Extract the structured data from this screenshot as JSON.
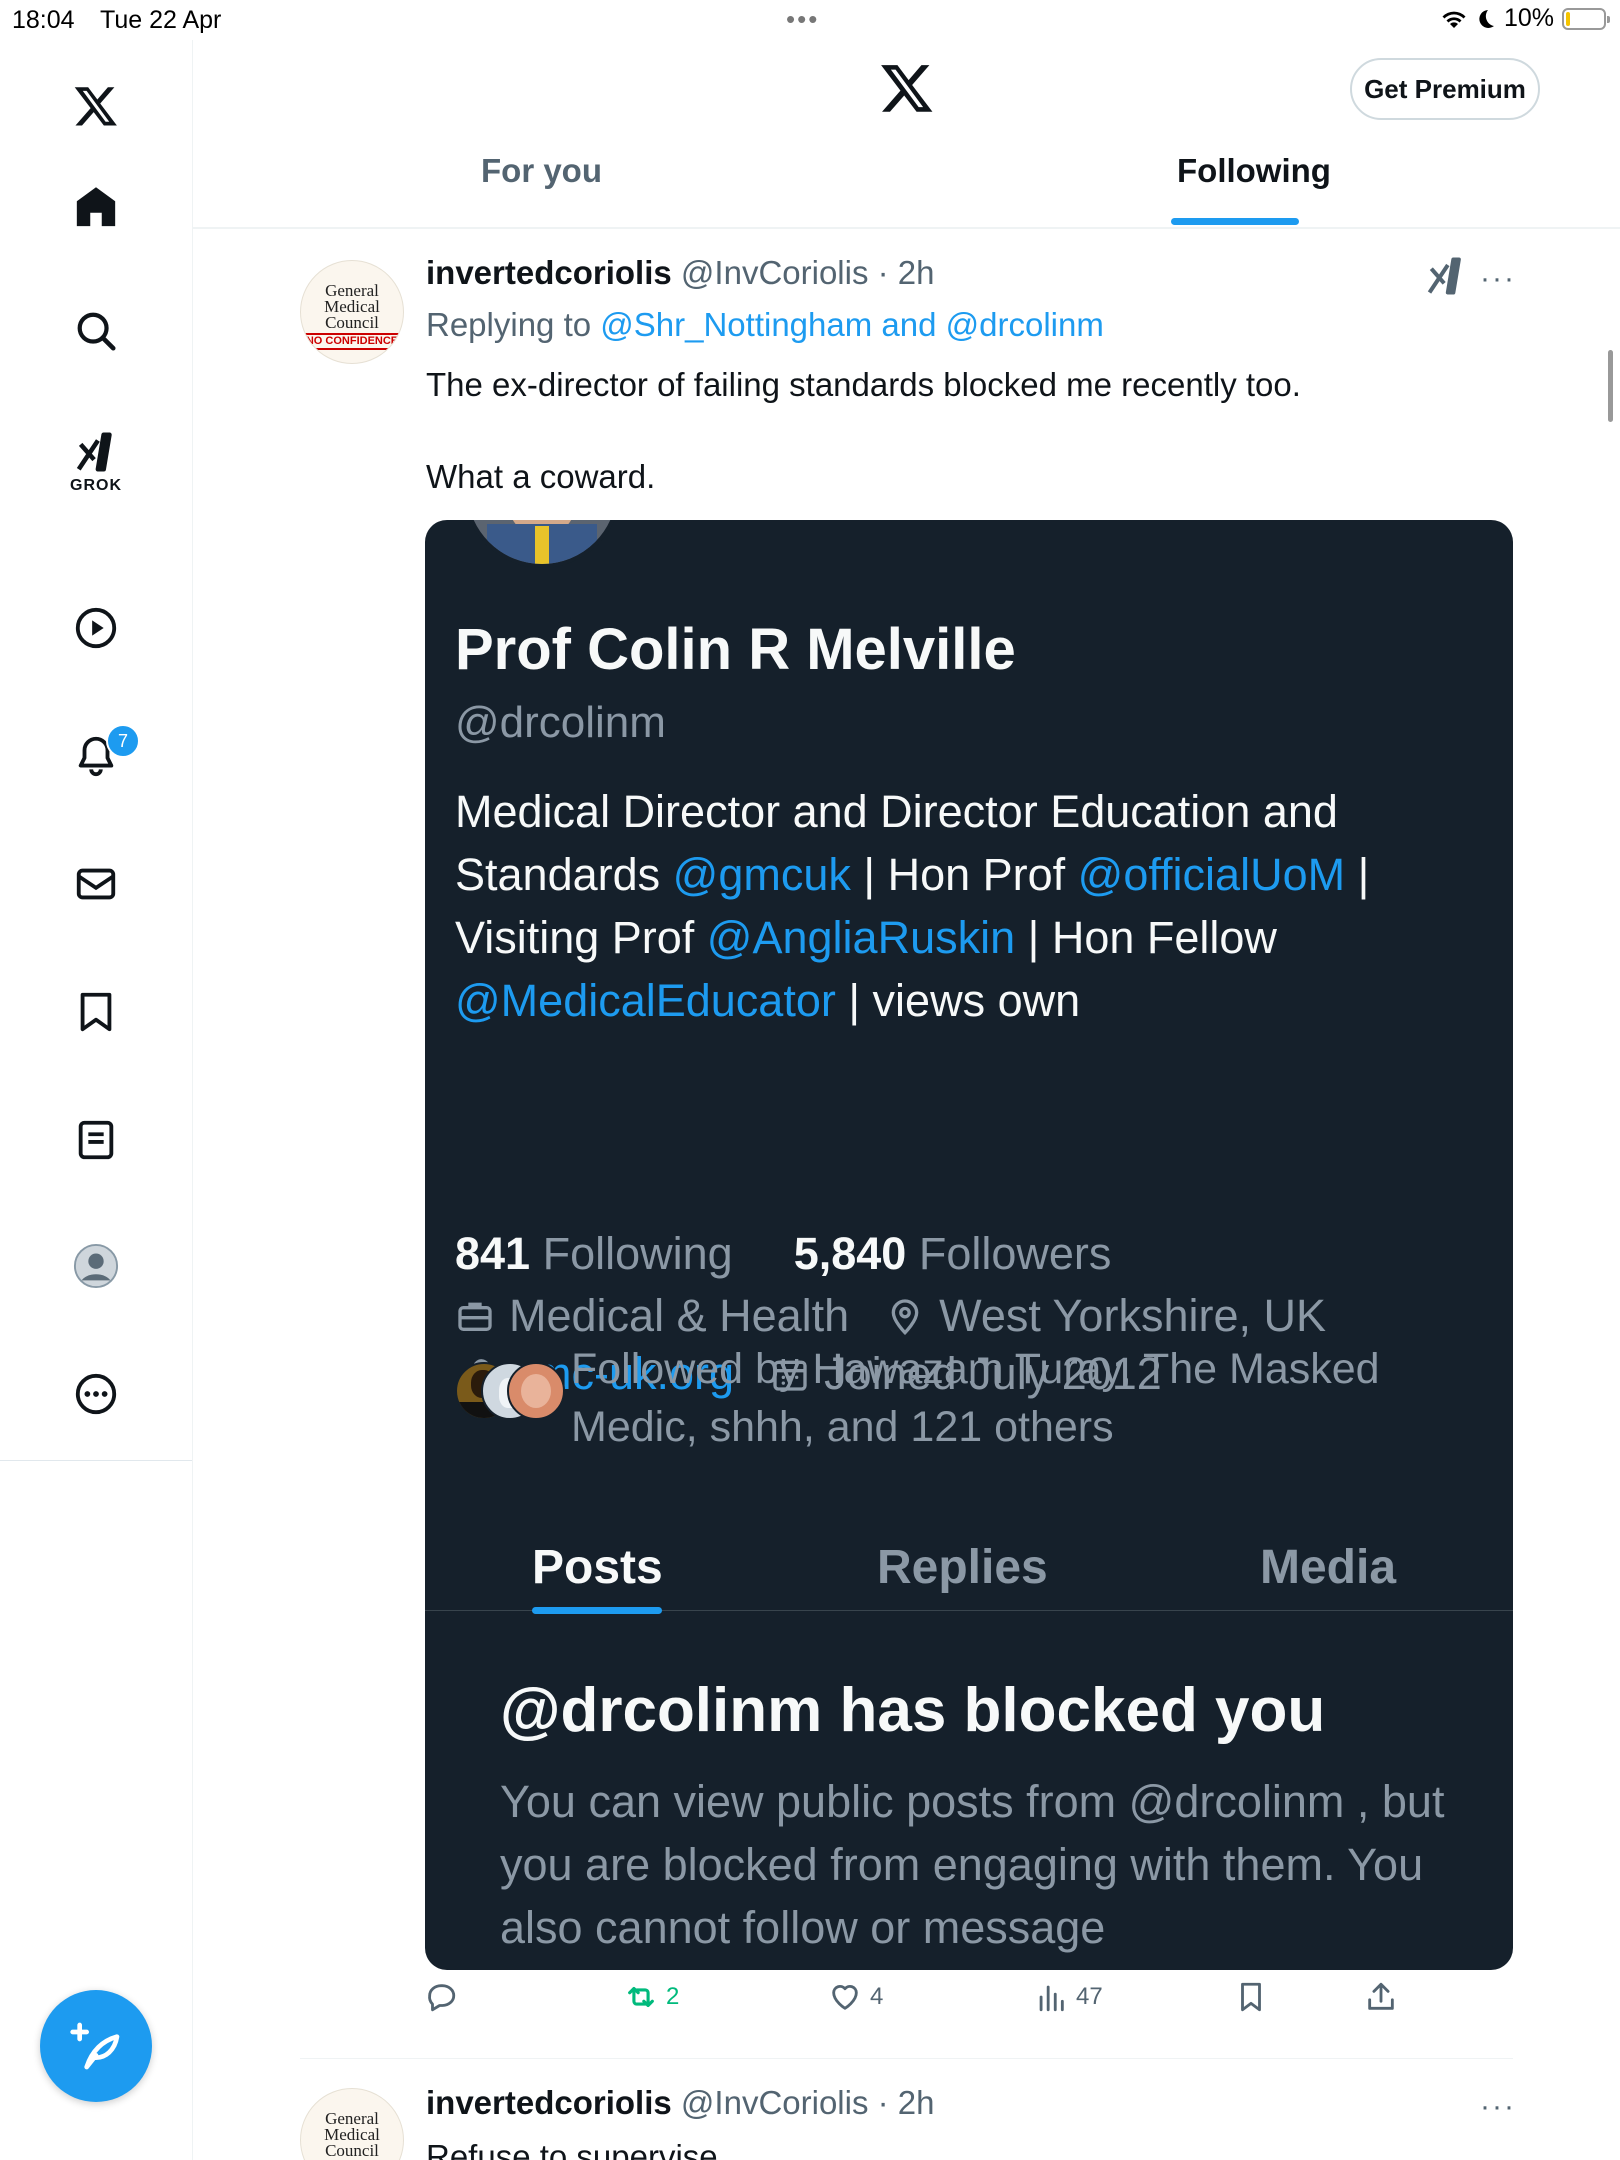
{
  "status_bar": {
    "time": "18:04",
    "date": "Tue 22 Apr",
    "battery": "10%",
    "battery_level": 0.1
  },
  "sidebar": {
    "items": [
      {
        "icon": "x-logo-icon"
      },
      {
        "icon": "home-icon"
      },
      {
        "icon": "search-icon"
      },
      {
        "icon": "grok-icon",
        "label": "GROK"
      },
      {
        "icon": "video-icon"
      },
      {
        "icon": "bell-icon",
        "badge": "7"
      },
      {
        "icon": "mail-icon"
      },
      {
        "icon": "bookmark-icon"
      },
      {
        "icon": "lists-icon"
      },
      {
        "icon": "profile-icon"
      },
      {
        "icon": "more-circle-icon"
      }
    ],
    "compose_icon": "compose-feather-icon"
  },
  "header": {
    "premium_label": "Get Premium",
    "tabs": [
      {
        "label": "For you",
        "active": false
      },
      {
        "label": "Following",
        "active": true
      }
    ]
  },
  "tweet": {
    "avatar_lines": [
      "General",
      "Medical",
      "Council"
    ],
    "avatar_stamp": "NO CONFIDENCE",
    "name": "invertedcoriolis",
    "handle": "@InvCoriolis",
    "time": "· 2h",
    "replying_prefix": "Replying to ",
    "replying_user1": "@Shr_Nottingham",
    "replying_and": " and ",
    "replying_user2": "@drcolinm",
    "text": "The ex-director of failing standards blocked me recently too.\n\nWhat a coward.",
    "card": {
      "name": "Prof Colin R Melville",
      "handle": "@drcolinm",
      "bio": [
        {
          "t": "Medical Director and Director Education and Standards ",
          "link": false
        },
        {
          "t": "@gmcuk",
          "link": true
        },
        {
          "t": " | Hon Prof ",
          "link": false
        },
        {
          "t": "@officialUoM",
          "link": true
        },
        {
          "t": " | Visiting Prof ",
          "link": false
        },
        {
          "t": "@AngliaRuskin",
          "link": true
        },
        {
          "t": " | Hon Fellow ",
          "link": false
        },
        {
          "t": "@MedicalEducator",
          "link": true
        },
        {
          "t": " | views own",
          "link": false
        }
      ],
      "category": "Medical & Health",
      "location": "West Yorkshire, UK",
      "website": "gmc-uk.org",
      "joined": "Joined July 2012",
      "following_count": "841",
      "following_label": " Following",
      "followers_count": "5,840",
      "followers_label": " Followers",
      "followed_by": "Followed by Hawazam Turay, The Masked Medic, shhh, and 121 others",
      "tabs": [
        "Posts",
        "Replies",
        "Media"
      ],
      "blocked_title": "@drcolinm has blocked you",
      "blocked_desc": "You can view public posts from @drcolinm , but you are blocked from engaging with them. You also cannot follow or message"
    },
    "actions": {
      "replies": "",
      "reposts": "2",
      "likes": "4",
      "views": "47"
    }
  },
  "tweet2": {
    "name": "invertedcoriolis",
    "handle": "@InvCoriolis",
    "time": "· 2h",
    "text": "Refuse to supervise"
  },
  "colors": {
    "accent": "#1d9bf0",
    "repost": "#00ba7c",
    "card_bg": "#15202b"
  }
}
